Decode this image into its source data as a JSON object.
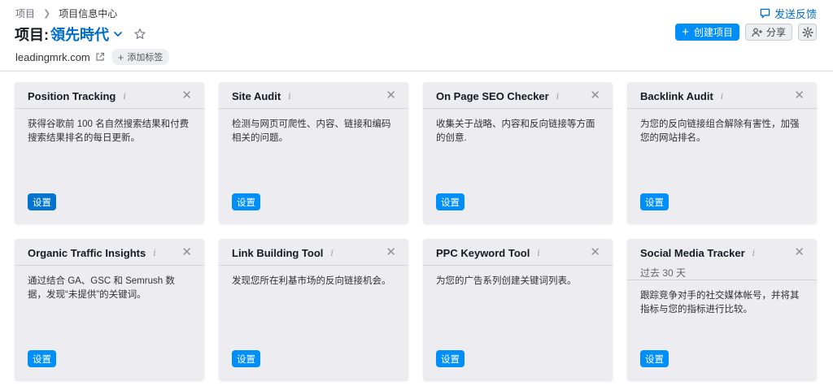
{
  "breadcrumb": {
    "root": "项目",
    "current": "项目信息中心"
  },
  "feedback": {
    "label": "发送反馈",
    "icon": "chat-bubble-icon"
  },
  "title": {
    "prefix": "项目:",
    "project_name": "領先時代"
  },
  "domain": {
    "name": "leadingmrk.com",
    "add_tag_label": "添加标签"
  },
  "actions": {
    "create_label": "创建项目",
    "share_label": "分享"
  },
  "colors": {
    "accent": "#008ff8",
    "link": "#006dca",
    "card_bg": "#ececf1"
  },
  "cards": [
    {
      "title": "Position Tracking",
      "desc": "获得谷歌前 100 名自然搜索结果和付费搜索结果排名的每日更新。",
      "button": "设置"
    },
    {
      "title": "Site Audit",
      "desc": "检测与网页可爬性、内容、链接和编码相关的问题。",
      "button": "设置"
    },
    {
      "title": "On Page SEO Checker",
      "desc": "收集关于战略、内容和反向链接等方面的创意.",
      "button": "设置"
    },
    {
      "title": "Backlink Audit",
      "desc": "为您的反向链接组合解除有害性，加强您的网站排名。",
      "button": "设置"
    },
    {
      "title": "Organic Traffic Insights",
      "desc": "通过结合 GA、GSC 和 Semrush 数据，发现“未提供”的关键词。",
      "button": "设置"
    },
    {
      "title": "Link Building Tool",
      "desc": "发现您所在利基市场的反向链接机会。",
      "button": "设置"
    },
    {
      "title": "PPC Keyword Tool",
      "desc": "为您的广告系列创建关键词列表。",
      "button": "设置"
    },
    {
      "title": "Social Media Tracker",
      "subtitle": "过去 30 天",
      "desc": "跟踪竞争对手的社交媒体帐号，并将其指标与您的指标进行比较。",
      "button": "设置"
    }
  ]
}
